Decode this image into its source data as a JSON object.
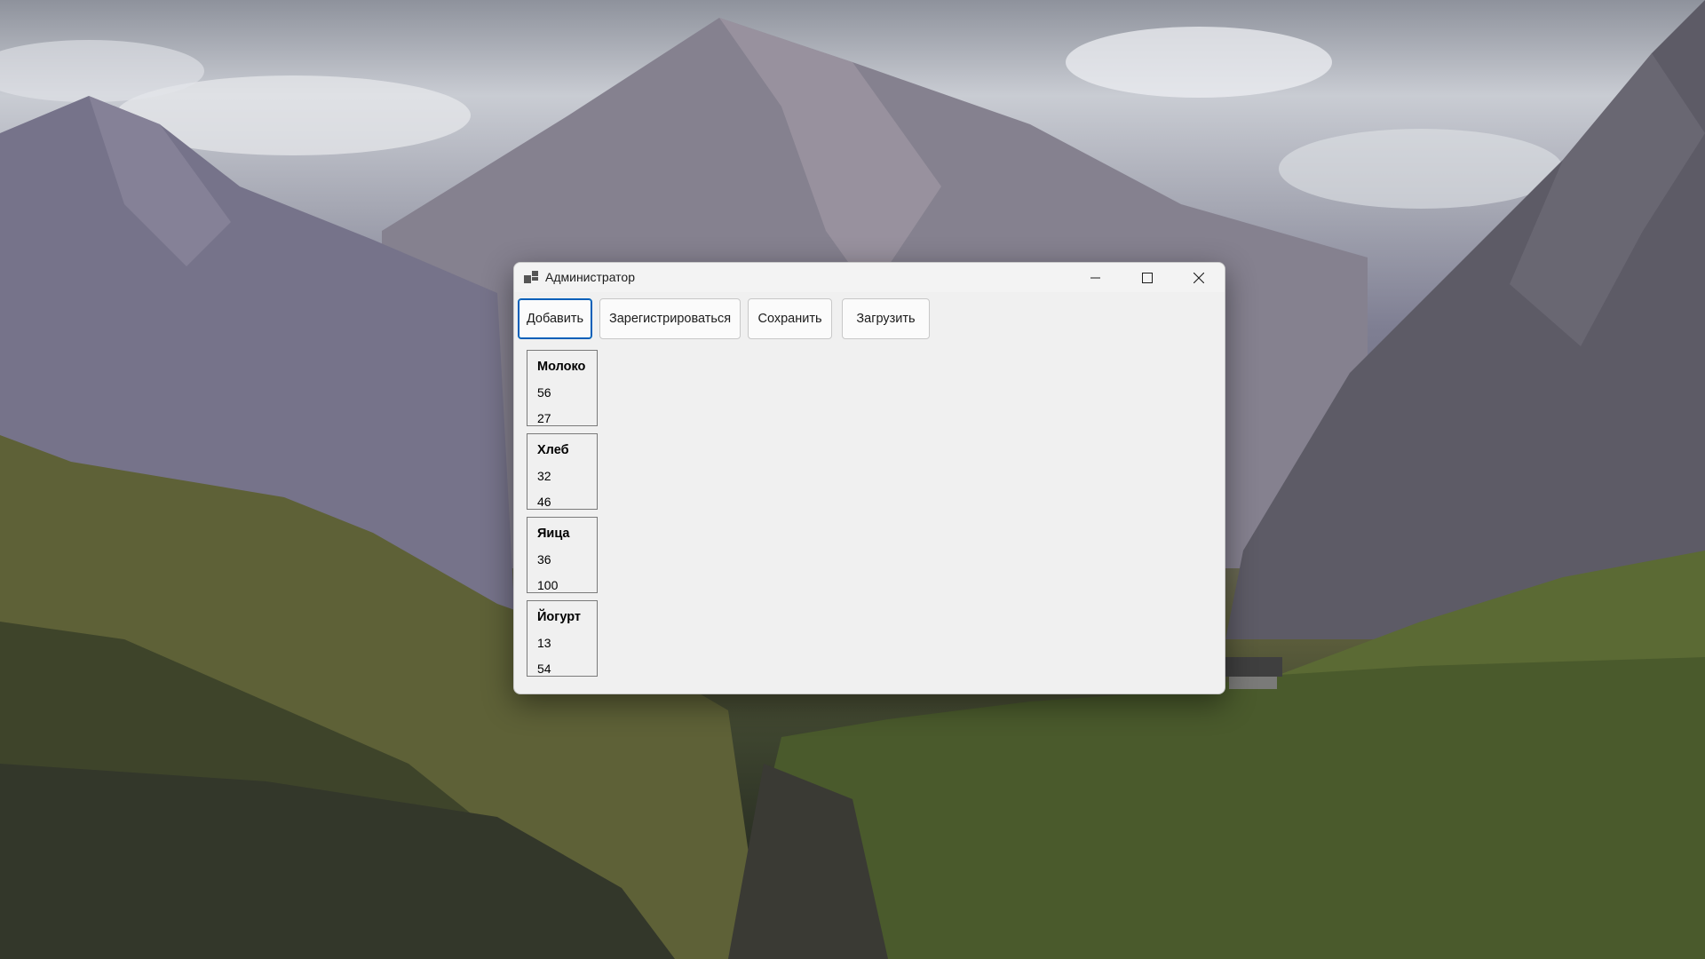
{
  "window": {
    "title": "Администратор"
  },
  "toolbar": {
    "add_label": "Добавить",
    "register_label": "Зарегистрироваться",
    "save_label": "Сохранить",
    "load_label": "Загрузить"
  },
  "products": [
    {
      "name": "Молоко",
      "value1": "56",
      "value2": "27"
    },
    {
      "name": "Хлеб",
      "value1": "32",
      "value2": "46"
    },
    {
      "name": "Яица",
      "value1": "36",
      "value2": "100"
    },
    {
      "name": "Йогурт",
      "value1": "13",
      "value2": "54"
    }
  ],
  "colors": {
    "window_bg": "#f0f0f0",
    "focus_accent": "#005fb8",
    "card_border": "#7a7a7a"
  },
  "icons": {
    "app": "app-window-icon",
    "minimize": "minimize-icon",
    "maximize": "maximize-icon",
    "close": "close-icon"
  }
}
